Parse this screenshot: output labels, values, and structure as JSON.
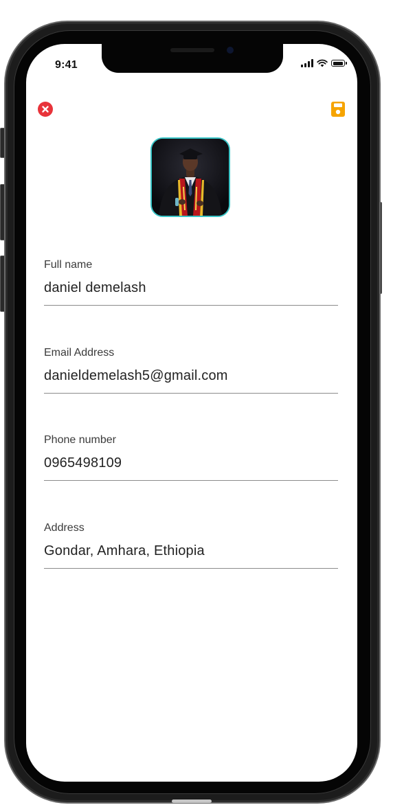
{
  "status_bar": {
    "time": "9:41",
    "signal_icon": "cellular-signal-icon",
    "wifi_icon": "wifi-icon",
    "battery_icon": "battery-icon"
  },
  "toolbar": {
    "close_icon": "close-circle-icon",
    "close_color": "#e8333a",
    "save_icon": "floppy-disk-icon",
    "save_color": "#f6a400"
  },
  "profile": {
    "avatar_description_icon": "profile-photo",
    "avatar_border_color": "#38c4c6"
  },
  "form": {
    "full_name": {
      "label": "Full name",
      "value": "daniel demelash"
    },
    "email": {
      "label": "Email Address",
      "value": "danieldemelash5@gmail.com"
    },
    "phone": {
      "label": "Phone number",
      "value": "0965498109"
    },
    "address": {
      "label": "Address",
      "value": "Gondar, Amhara, Ethiopia"
    }
  }
}
